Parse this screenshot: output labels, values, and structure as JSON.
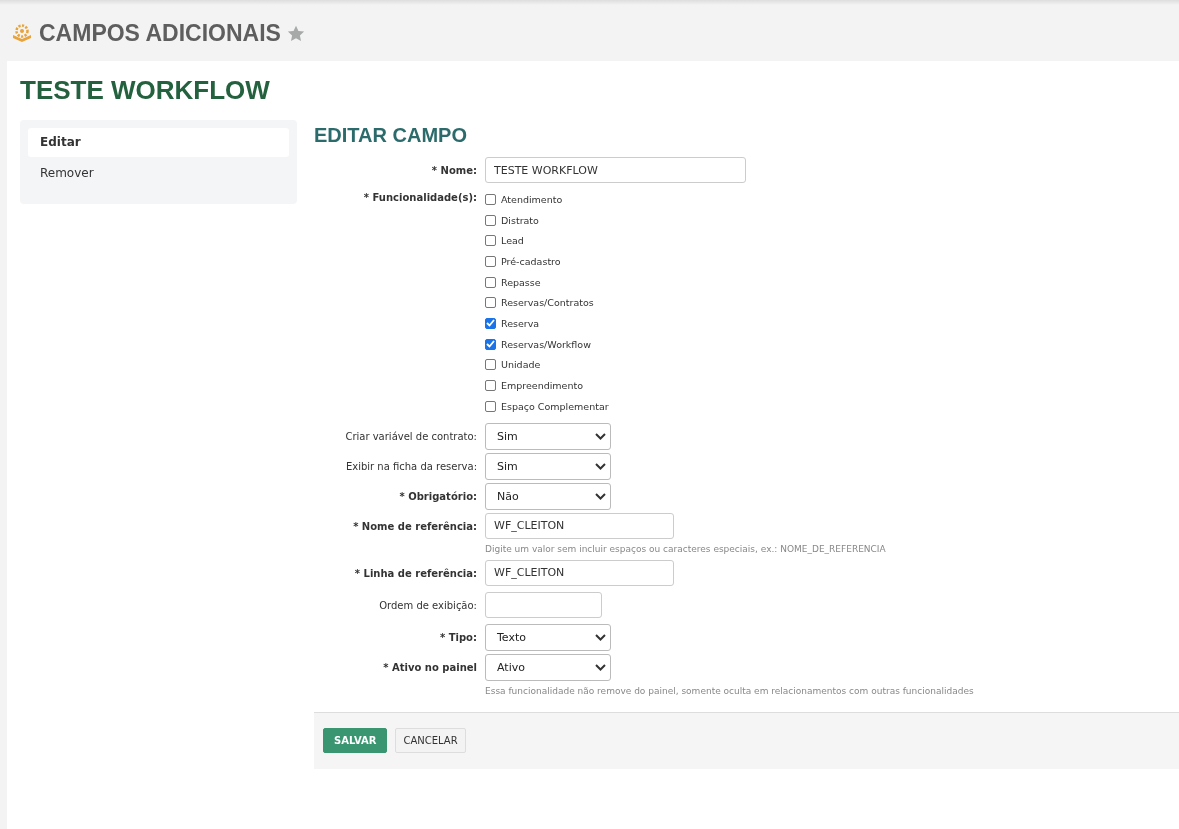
{
  "page_header": {
    "title": "CAMPOS ADICIONAIS"
  },
  "record_title": "TESTE WORKFLOW",
  "sidebar": {
    "items": [
      {
        "label": "Editar",
        "selected": true
      },
      {
        "label": "Remover",
        "selected": false
      }
    ]
  },
  "form": {
    "title": "EDITAR CAMPO",
    "fields": [
      {
        "kind": "text",
        "label": "* Nome:",
        "bold": true,
        "value": "TESTE WORKFLOW"
      },
      {
        "kind": "checkboxes",
        "label": "* Funcionalidade(s):",
        "bold": true,
        "items": [
          {
            "label": "Atendimento",
            "checked": false
          },
          {
            "label": "Distrato",
            "checked": false
          },
          {
            "label": "Lead",
            "checked": false
          },
          {
            "label": "Pré-cadastro",
            "checked": false
          },
          {
            "label": "Repasse",
            "checked": false
          },
          {
            "label": "Reservas/Contratos",
            "checked": false
          },
          {
            "label": "Reserva",
            "checked": true
          },
          {
            "label": "Reservas/Workflow",
            "checked": true
          },
          {
            "label": "Unidade",
            "checked": false
          },
          {
            "label": "Empreendimento",
            "checked": false
          },
          {
            "label": "Espaço Complementar",
            "checked": false
          }
        ]
      },
      {
        "kind": "select",
        "label": "Criar variável de contrato:",
        "bold": false,
        "value": "Sim"
      },
      {
        "kind": "select",
        "label": "Exibir na ficha da reserva:",
        "bold": false,
        "value": "Sim"
      },
      {
        "kind": "select",
        "label": "* Obrigatório:",
        "bold": true,
        "value": "Não"
      },
      {
        "kind": "text",
        "label": "* Nome de referência:",
        "bold": true,
        "value": "WF_CLEITON",
        "hint": "Digite um valor sem incluir espaços ou caracteres especiais, ex.: NOME_DE_REFERENCIA"
      },
      {
        "kind": "text",
        "label": "* Linha de referência:",
        "bold": true,
        "value": "WF_CLEITON"
      },
      {
        "kind": "text",
        "label": "Ordem de exibição:",
        "bold": false
      },
      {
        "kind": "select",
        "label": "* Tipo:",
        "bold": true,
        "value": "Texto"
      },
      {
        "kind": "select",
        "label": "* Ativo no painel",
        "bold": true,
        "value": "Ativo",
        "hint": "Essa funcionalidade não remove do painel, somente oculta em relacionamentos com outras funcionalidades"
      }
    ]
  },
  "buttons": [
    {
      "label": "SALVAR",
      "kind": "primary"
    },
    {
      "label": "CANCELAR",
      "kind": "secondary"
    }
  ]
}
